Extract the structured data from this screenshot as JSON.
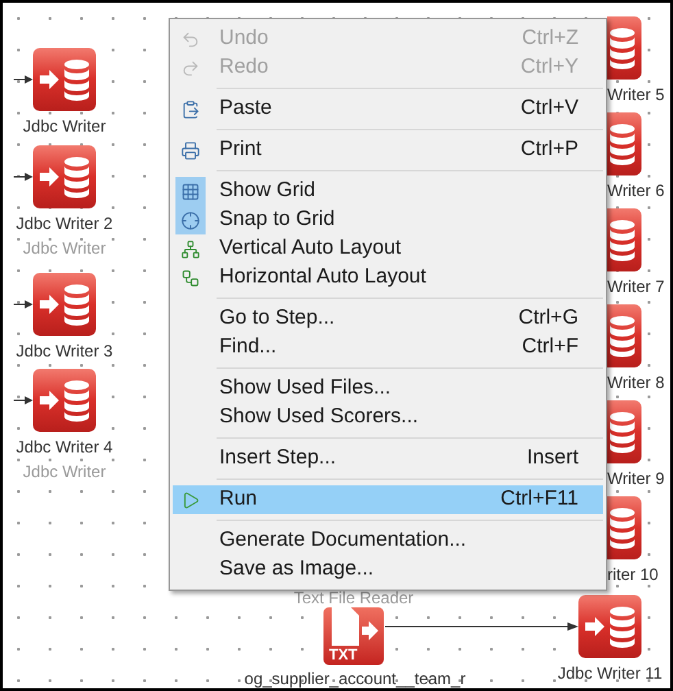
{
  "canvas": {
    "nodes": [
      {
        "kind": "jdbc",
        "label": "Jdbc Writer"
      },
      {
        "kind": "jdbc",
        "label": "Jdbc Writer 2",
        "sublabel": "Jdbc Writer"
      },
      {
        "kind": "jdbc",
        "label": "Jdbc Writer 3"
      },
      {
        "kind": "jdbc",
        "label": "Jdbc Writer 4",
        "sublabel": "Jdbc Writer"
      },
      {
        "kind": "jdbc",
        "label": "Writer 5"
      },
      {
        "kind": "jdbc",
        "label": "Writer 6"
      },
      {
        "kind": "jdbc",
        "label": "Writer 7"
      },
      {
        "kind": "jdbc",
        "label": "Writer 8"
      },
      {
        "kind": "jdbc",
        "label": "Writer 9"
      },
      {
        "kind": "jdbc",
        "label": "riter 10"
      },
      {
        "kind": "jdbc",
        "label": "Jdbc Writer 11"
      },
      {
        "kind": "txt",
        "label": "og_supplier_account__team_r",
        "sublabel": "Text File Reader",
        "badge": "TXT"
      }
    ]
  },
  "context_menu": {
    "items": [
      {
        "kind": "item",
        "label": "Undo",
        "shortcut": "Ctrl+Z",
        "disabled": true,
        "highlighted": false
      },
      {
        "kind": "item",
        "label": "Redo",
        "shortcut": "Ctrl+Y",
        "disabled": true,
        "highlighted": false
      },
      {
        "kind": "separator"
      },
      {
        "kind": "item",
        "label": "Paste",
        "shortcut": "Ctrl+V",
        "disabled": false,
        "highlighted": false
      },
      {
        "kind": "separator"
      },
      {
        "kind": "item",
        "label": "Print",
        "shortcut": "Ctrl+P",
        "disabled": false,
        "highlighted": false
      },
      {
        "kind": "separator"
      },
      {
        "kind": "check",
        "label": "Show Grid",
        "checked": true,
        "disabled": false,
        "highlighted": false
      },
      {
        "kind": "check",
        "label": "Snap to Grid",
        "checked": true,
        "disabled": false,
        "highlighted": false
      },
      {
        "kind": "item",
        "label": "Vertical Auto Layout",
        "disabled": false,
        "highlighted": false
      },
      {
        "kind": "item",
        "label": "Horizontal Auto Layout",
        "disabled": false,
        "highlighted": false
      },
      {
        "kind": "separator"
      },
      {
        "kind": "item",
        "label": "Go to Step...",
        "shortcut": "Ctrl+G",
        "disabled": false,
        "highlighted": false
      },
      {
        "kind": "item",
        "label": "Find...",
        "shortcut": "Ctrl+F",
        "disabled": false,
        "highlighted": false
      },
      {
        "kind": "separator"
      },
      {
        "kind": "item",
        "label": "Show Used Files...",
        "disabled": false,
        "highlighted": false
      },
      {
        "kind": "item",
        "label": "Show Used Scorers...",
        "disabled": false,
        "highlighted": false
      },
      {
        "kind": "separator"
      },
      {
        "kind": "item",
        "label": "Insert Step...",
        "shortcut": "Insert",
        "disabled": false,
        "highlighted": false
      },
      {
        "kind": "separator"
      },
      {
        "kind": "item",
        "label": "Run",
        "shortcut": "Ctrl+F11",
        "disabled": false,
        "highlighted": true
      },
      {
        "kind": "separator"
      },
      {
        "kind": "item",
        "label": "Generate Documentation...",
        "disabled": false,
        "highlighted": false
      },
      {
        "kind": "item",
        "label": "Save as Image...",
        "disabled": false,
        "highlighted": false
      }
    ]
  }
}
